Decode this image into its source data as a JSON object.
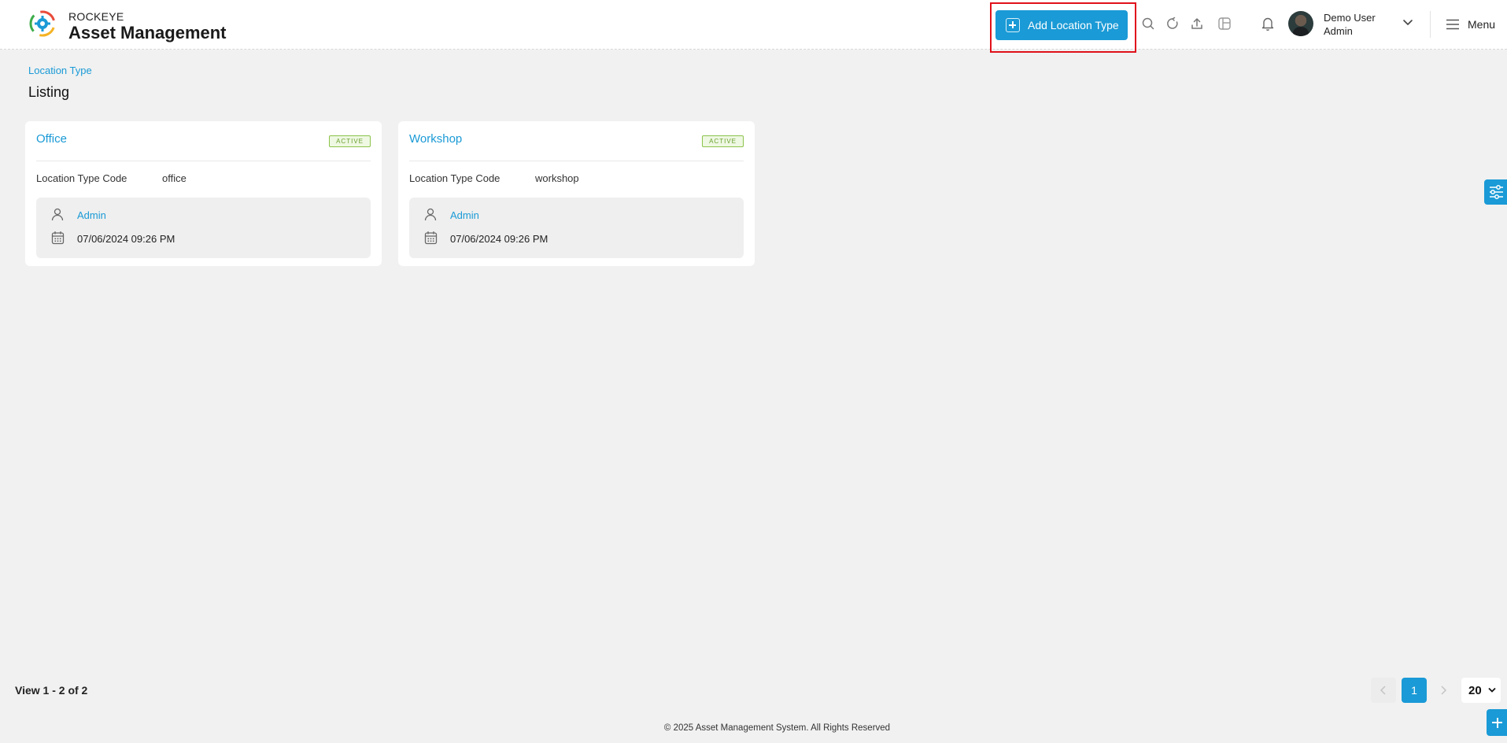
{
  "brand": {
    "small": "ROCKEYE",
    "big": "Asset Management"
  },
  "header": {
    "add_button_label": "Add Location Type",
    "user_name": "Demo User",
    "user_role": "Admin",
    "menu_label": "Menu"
  },
  "breadcrumb": "Location Type",
  "page_title": "Listing",
  "cards": [
    {
      "title": "Office",
      "status": "ACTIVE",
      "code_label": "Location Type Code",
      "code_value": "office",
      "created_by": "Admin",
      "created_at": "07/06/2024 09:26 PM"
    },
    {
      "title": "Workshop",
      "status": "ACTIVE",
      "code_label": "Location Type Code",
      "code_value": "workshop",
      "created_by": "Admin",
      "created_at": "07/06/2024 09:26 PM"
    }
  ],
  "pagination": {
    "view_text": "View 1 - 2 of 2",
    "current_page": "1",
    "per_page": "20"
  },
  "footer": {
    "copyright": "© 2025 Asset Management System. All Rights Reserved"
  },
  "colors": {
    "accent": "#1a9ad6",
    "active_badge": "#8cc34a",
    "highlight": "#e0111b"
  }
}
